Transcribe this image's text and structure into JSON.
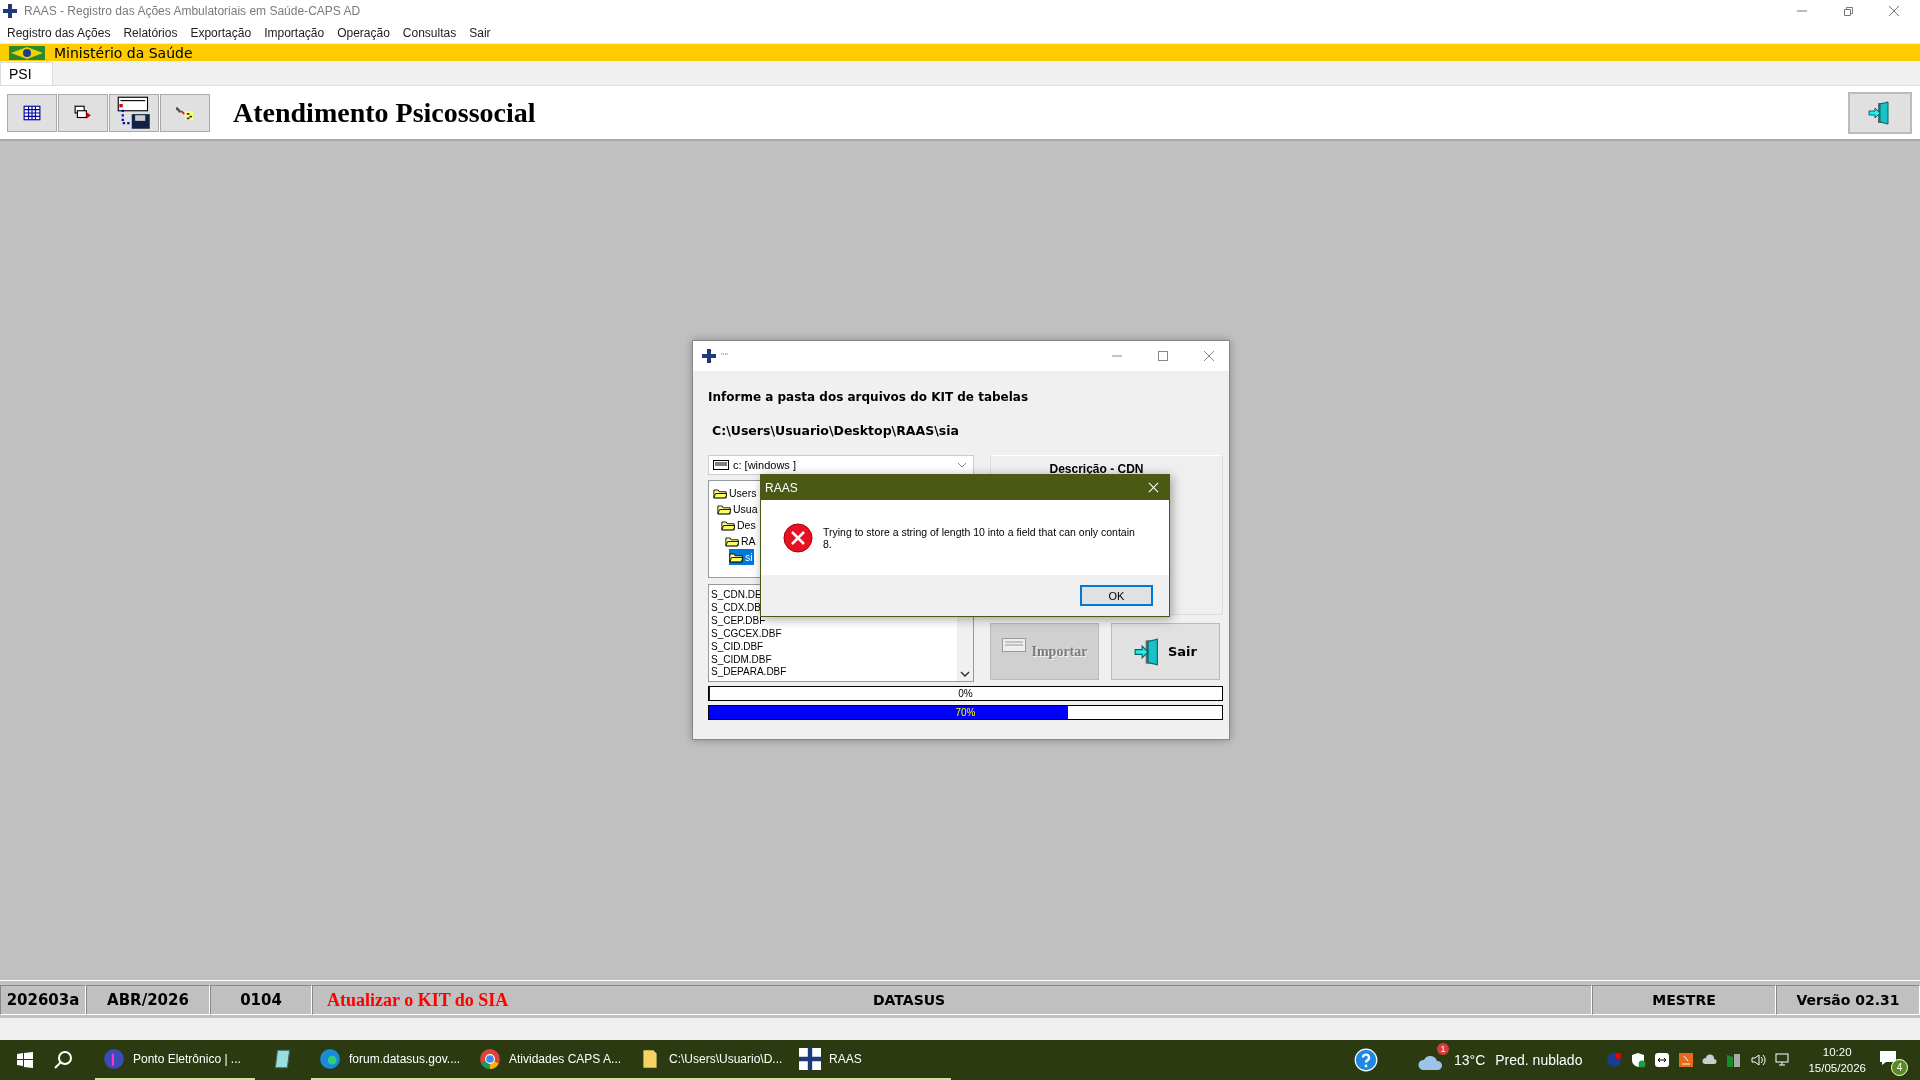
{
  "window": {
    "title": "RAAS - Registro das Ações Ambulatoriais em Saúde-CAPS AD"
  },
  "menu": [
    "Registro das Ações",
    "Relatórios",
    "Exportação",
    "Importação",
    "Operação",
    "Consultas",
    "Sair"
  ],
  "banner": {
    "text": "Ministério da Saúde"
  },
  "tabs": [
    {
      "label": "PSI",
      "selected": true
    }
  ],
  "toolbar": {
    "title": "Atendimento Psicossocial"
  },
  "dialog": {
    "title": "''''",
    "heading": "Informe a pasta dos arquivos do KIT de tabelas",
    "path": "C:\\Users\\Usuario\\Desktop\\RAAS\\sia",
    "drive": "c: [windows ]",
    "panel_title": "Descrição - CDN",
    "tree": [
      {
        "label": "Users",
        "selected": false,
        "children": [
          {
            "label": "Usua",
            "selected": false,
            "children": [
              {
                "label": "Des",
                "selected": false,
                "children": [
                  {
                    "label": "RA",
                    "selected": false,
                    "children": [
                      {
                        "label": "si",
                        "selected": true
                      }
                    ]
                  }
                ]
              }
            ]
          }
        ]
      }
    ],
    "files": [
      "S_CDN.DE",
      "S_CDX.DB",
      "S_CEP.DBF",
      "S_CGCEX.DBF",
      "S_CID.DBF",
      "S_CIDM.DBF",
      "S_DEPARA.DBF"
    ],
    "buttons": [
      {
        "label": "Importar",
        "disabled": true
      },
      {
        "label": "Sair",
        "disabled": false
      }
    ],
    "progress": [
      {
        "reading": "0%",
        "level": 0
      },
      {
        "reading": "70%",
        "level": 0.7
      }
    ]
  },
  "message_box": {
    "title": "RAAS",
    "text": "Trying to store a string of length 10 into a field that can only contain 8.",
    "button": "OK"
  },
  "status_bar": {
    "cells": [
      "202603a",
      "ABR/2026",
      "0104"
    ],
    "notice": "Atualizar o KIT do SIA",
    "center": "DATASUS",
    "user": "MESTRE",
    "version": "Versão 02.31"
  },
  "taskbar": {
    "apps": [
      {
        "label": "Ponto Eletrônico | ...",
        "running": true
      },
      {
        "running": false
      },
      {
        "label": "forum.datasus.gov....",
        "running": true
      },
      {
        "label": "Atividades CAPS A...",
        "running": true
      },
      {
        "label": "C:\\Users\\Usuario\\D...",
        "running": true
      },
      {
        "label": "RAAS",
        "running": true
      }
    ],
    "weather_badge": "1",
    "temperature": "13°C",
    "weather": "Pred. nublado",
    "time": "10:20",
    "date": "15/05/2026",
    "notifications": "4"
  }
}
